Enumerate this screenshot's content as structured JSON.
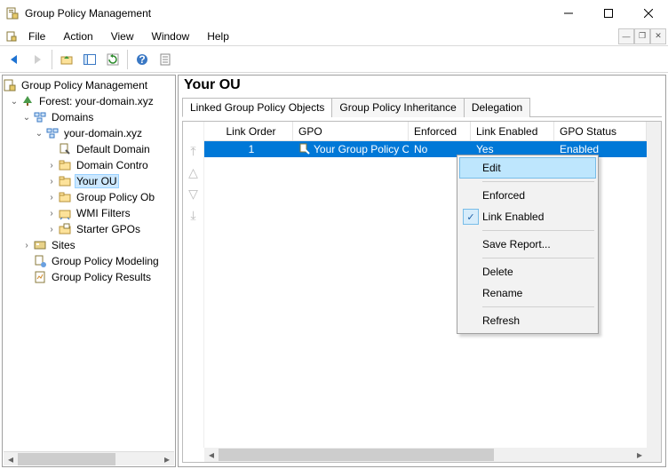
{
  "window": {
    "title": "Group Policy Management"
  },
  "menu": {
    "file": "File",
    "action": "Action",
    "view": "View",
    "window": "Window",
    "help": "Help"
  },
  "tree": {
    "root": "Group Policy Management",
    "forest": "Forest: your-domain.xyz",
    "domains": "Domains",
    "domain": "your-domain.xyz",
    "ddp": "Default Domain",
    "dc": "Domain Contro",
    "your_ou": "Your OU",
    "gpo": "Group Policy Ob",
    "wmi": "WMI Filters",
    "starter": "Starter GPOs",
    "sites": "Sites",
    "modeling": "Group Policy Modeling",
    "results": "Group Policy Results"
  },
  "main": {
    "heading": "Your OU",
    "tabs": {
      "linked": "Linked Group Policy Objects",
      "inheritance": "Group Policy Inheritance",
      "delegation": "Delegation"
    },
    "cols": {
      "order": "Link Order",
      "gpo": "GPO",
      "enforced": "Enforced",
      "link_enabled": "Link Enabled",
      "status": "GPO Status"
    },
    "row": {
      "order": "1",
      "gpo": "Your Group Policy O...",
      "enforced": "No",
      "link_enabled": "Yes",
      "status": "Enabled"
    }
  },
  "ctx": {
    "edit": "Edit",
    "enforced": "Enforced",
    "link_enabled": "Link Enabled",
    "save_report": "Save Report...",
    "delete": "Delete",
    "rename": "Rename",
    "refresh": "Refresh"
  }
}
